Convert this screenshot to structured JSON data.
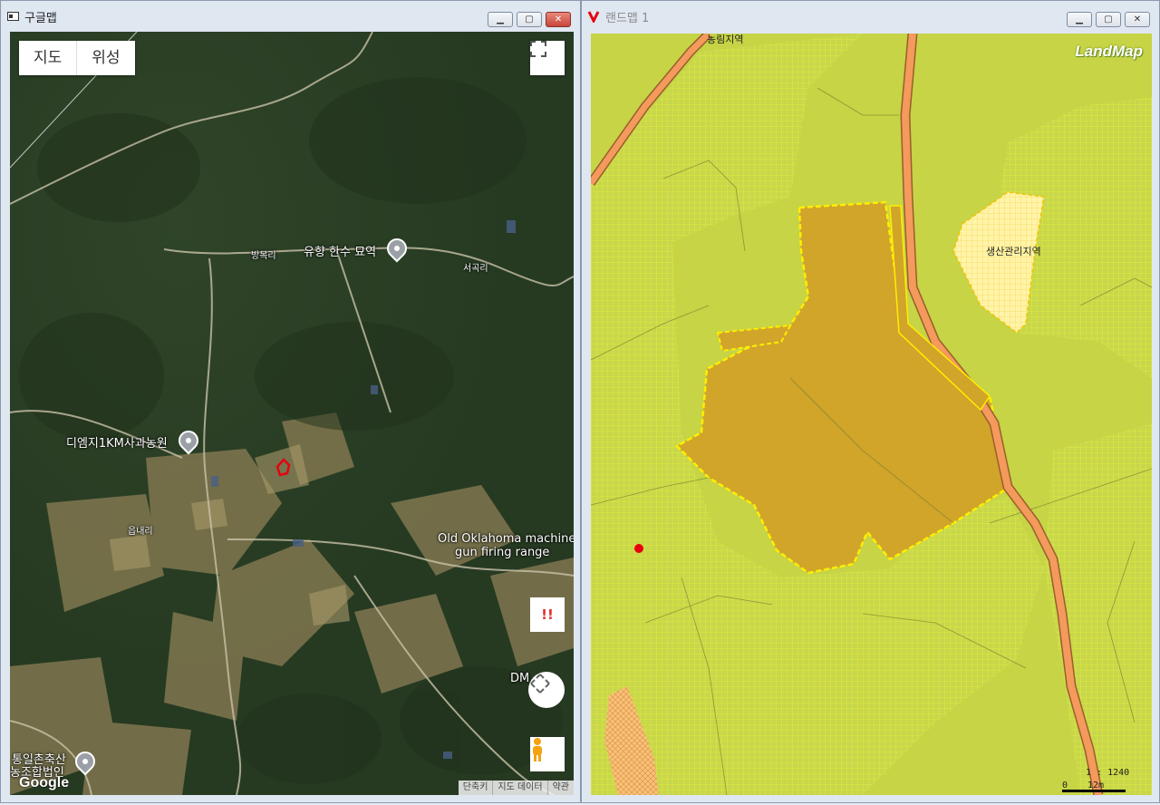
{
  "left_window": {
    "title": "구글맵",
    "map_types": [
      "지도",
      "위성"
    ],
    "labels": {
      "place1": "유향 한수 묘역",
      "village1": "방목리",
      "village2": "서곡리",
      "place2": "디엠지1KM사과농원",
      "village3": "읍내리",
      "place3_line1": "Old Oklahoma machine",
      "place3_line2": "gun firing range",
      "place4": "DM",
      "place5_line1": "통일촌축산",
      "place5_line2": "농조합법인"
    },
    "warning_symbol": "!!",
    "logo": "Google",
    "attribution": [
      "단축키",
      "지도 데이터",
      "약관"
    ]
  },
  "right_window": {
    "title": "랜드맵 1",
    "logo": "LandMap",
    "zone_labels": {
      "top": "농림지역",
      "production_management": "생산관리지역"
    },
    "scale_ratio": "1 : 1240",
    "scale_zero": "0",
    "scale_distance": "12m"
  },
  "colors": {
    "agri_forest": "#c6d445",
    "highlight_parcel": "#d1a42a",
    "production_zone": "#fff2a0",
    "road": "#f39a5c",
    "marker": "#e8000e"
  }
}
